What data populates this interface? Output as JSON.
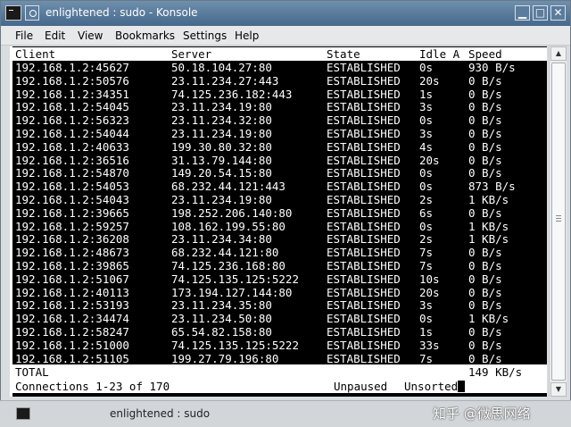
{
  "window": {
    "title": "enlightened : sudo - Konsole"
  },
  "menu": [
    "File",
    "Edit",
    "View",
    "Bookmarks",
    "Settings",
    "Help"
  ],
  "table": {
    "headers": [
      "Client",
      "Server",
      "State",
      "Idle A",
      "Speed"
    ],
    "rows": [
      [
        "192.168.1.2:45627",
        "50.18.104.27:80",
        "ESTABLISHED",
        "0s",
        "930 B/s"
      ],
      [
        "192.168.1.2:50576",
        "23.11.234.27:443",
        "ESTABLISHED",
        "20s",
        "0 B/s"
      ],
      [
        "192.168.1.2:34351",
        "74.125.236.182:443",
        "ESTABLISHED",
        "1s",
        "0 B/s"
      ],
      [
        "192.168.1.2:54045",
        "23.11.234.19:80",
        "ESTABLISHED",
        "3s",
        "0 B/s"
      ],
      [
        "192.168.1.2:56323",
        "23.11.234.32:80",
        "ESTABLISHED",
        "0s",
        "0 B/s"
      ],
      [
        "192.168.1.2:54044",
        "23.11.234.19:80",
        "ESTABLISHED",
        "3s",
        "0 B/s"
      ],
      [
        "192.168.1.2:40633",
        "199.30.80.32:80",
        "ESTABLISHED",
        "4s",
        "0 B/s"
      ],
      [
        "192.168.1.2:36516",
        "31.13.79.144:80",
        "ESTABLISHED",
        "20s",
        "0 B/s"
      ],
      [
        "192.168.1.2:54870",
        "149.20.54.15:80",
        "ESTABLISHED",
        "0s",
        "0 B/s"
      ],
      [
        "192.168.1.2:54053",
        "68.232.44.121:443",
        "ESTABLISHED",
        "0s",
        "873 B/s"
      ],
      [
        "192.168.1.2:54043",
        "23.11.234.19:80",
        "ESTABLISHED",
        "2s",
        "1 KB/s"
      ],
      [
        "192.168.1.2:39665",
        "198.252.206.140:80",
        "ESTABLISHED",
        "6s",
        "0 B/s"
      ],
      [
        "192.168.1.2:59257",
        "108.162.199.55:80",
        "ESTABLISHED",
        "0s",
        "1 KB/s"
      ],
      [
        "192.168.1.2:36208",
        "23.11.234.34:80",
        "ESTABLISHED",
        "2s",
        "1 KB/s"
      ],
      [
        "192.168.1.2:48673",
        "68.232.44.121:80",
        "ESTABLISHED",
        "7s",
        "0 B/s"
      ],
      [
        "192.168.1.2:39865",
        "74.125.236.168:80",
        "ESTABLISHED",
        "7s",
        "0 B/s"
      ],
      [
        "192.168.1.2:51067",
        "74.125.135.125:5222",
        "ESTABLISHED",
        "10s",
        "0 B/s"
      ],
      [
        "192.168.1.2:40113",
        "173.194.127.144:80",
        "ESTABLISHED",
        "20s",
        "0 B/s"
      ],
      [
        "192.168.1.2:53193",
        "23.11.234.35:80",
        "ESTABLISHED",
        "3s",
        "0 B/s"
      ],
      [
        "192.168.1.2:34474",
        "23.11.234.50:80",
        "ESTABLISHED",
        "0s",
        "1 KB/s"
      ],
      [
        "192.168.1.2:58247",
        "65.54.82.158:80",
        "ESTABLISHED",
        "1s",
        "0 B/s"
      ],
      [
        "192.168.1.2:51000",
        "74.125.135.125:5222",
        "ESTABLISHED",
        "33s",
        "0 B/s"
      ],
      [
        "192.168.1.2:51105",
        "199.27.79.196:80",
        "ESTABLISHED",
        "7s",
        "0 B/s"
      ]
    ]
  },
  "footer": {
    "total_label": "TOTAL",
    "total_speed": "149 KB/s",
    "connections": "Connections 1-23 of 170",
    "pause_state": "Unpaused",
    "sort_state": "Unsorted"
  },
  "taskbar": {
    "task_label": "enlightened : sudo"
  },
  "watermark": "知乎 @微思网络",
  "colors": {
    "titlebar": "#45688c",
    "terminal_bg": "#000000",
    "terminal_fg": "#ffffff"
  }
}
